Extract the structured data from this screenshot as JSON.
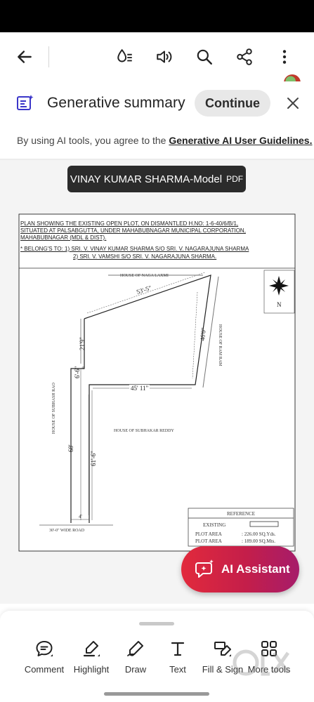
{
  "toolbar": {
    "icons": [
      "back-arrow-icon",
      "read-mode-icon",
      "read-aloud-icon",
      "search-icon",
      "share-icon",
      "more-vertical-icon"
    ]
  },
  "banner": {
    "title": "Generative summary",
    "continue_label": "Continue",
    "notice_prefix": "By using AI tools, you agree to the ",
    "notice_link": "Generative AI User Guidelines."
  },
  "file": {
    "name": "VINAY KUMAR SHARMA-Model",
    "ext": "PDF"
  },
  "plan": {
    "header_line1": "PLAN SHOWING THE EXISTING OPEN PLOT, ON DISMANTLED H.NO: 1-6-40/6/B/1,",
    "header_line2": "SITUATED AT PALSABGUTTA, UNDER MAHABUBNAGAR MUNICIPAL CORPORATION,",
    "header_line3": "MAHABUBNAGAR (MDL & DIST).",
    "belongs_line1": "* BELONG'S TO: 1)  SRI. V. VINAY KUMAR SHARMA S/O SRI. V. NAGARAJUNA SHARMA",
    "belongs_line2": "2)  SRI. V. VAMSHI S/O SRI. V. NAGARAJUNA SHARMA.",
    "north": "N",
    "top_boundary": "HOUSE OF NAGA LAXMI",
    "right_boundary": "HOUSE OF RAM RAM",
    "left_boundary": "HOUSE OF SUBHASH RAO",
    "center_boundary": "HOUSE OF SUBHAKAR REDDY",
    "road": "30'-0\" WIDE ROAD",
    "dim_top": "53'-5\"",
    "dim_right": "46'0\"",
    "dim_upper_left": "21'9\"",
    "dim_step": "6'-6\"",
    "dim_step_width": "4'",
    "dim_middle": "45' 11\"",
    "dim_left": "68'",
    "dim_inner": "61'-6\"",
    "dim_bottom": "4'",
    "reference_title": "REFERENCE",
    "ref_existing": "EXISTING",
    "ref_area_label": "PLOT AREA",
    "ref_area_yds": ": 226.00  SQ.Yds.",
    "ref_area_label2": "PLOT AREA",
    "ref_area_mts": ": 189.00  SQ.Mts."
  },
  "ai_assistant": {
    "label": "AI Assistant"
  },
  "tools": [
    {
      "label": "Comment",
      "icon": "comment-icon"
    },
    {
      "label": "Highlight",
      "icon": "highlight-icon"
    },
    {
      "label": "Draw",
      "icon": "draw-icon"
    },
    {
      "label": "Text",
      "icon": "text-icon"
    },
    {
      "label": "Fill & Sign",
      "icon": "fill-sign-icon"
    },
    {
      "label": "More tools",
      "icon": "more-tools-icon"
    }
  ]
}
